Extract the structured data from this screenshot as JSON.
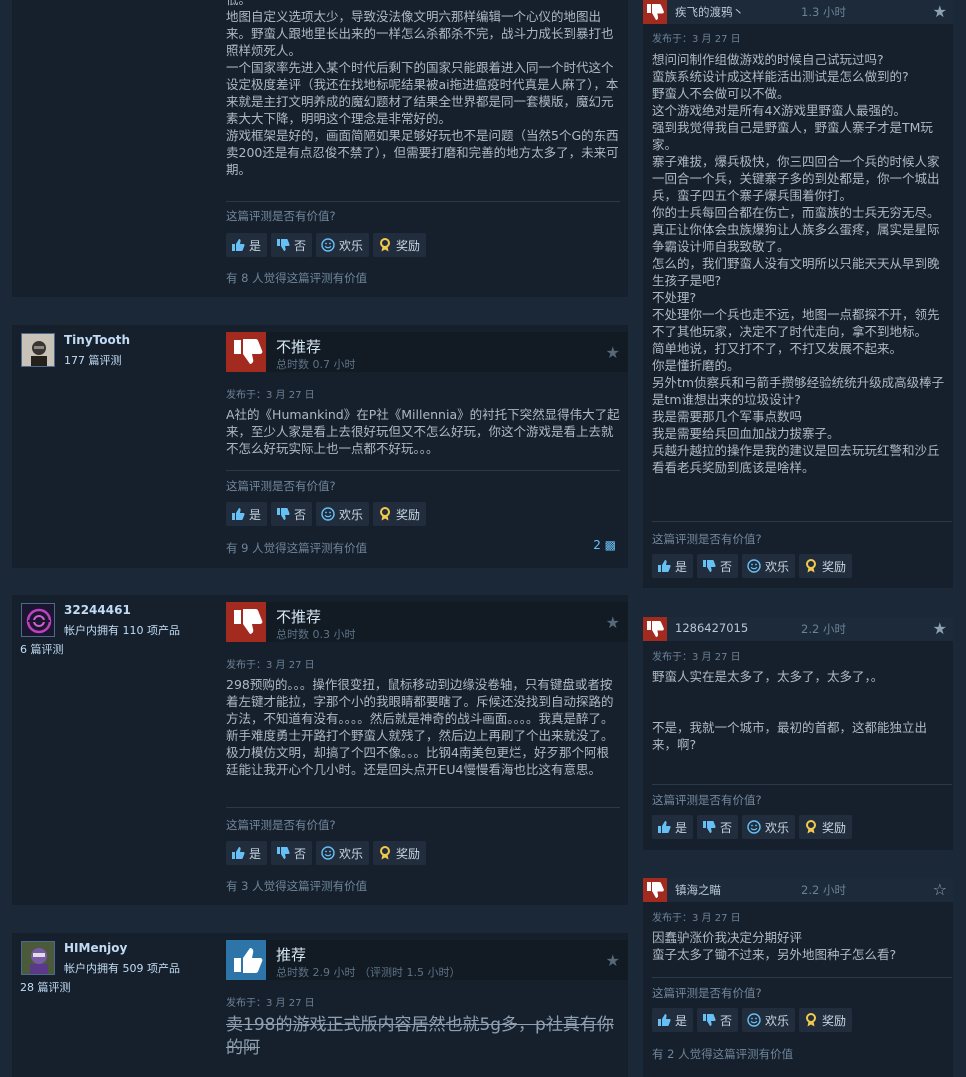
{
  "common": {
    "helpful_question": "这篇评测是否有价值?",
    "yes": "是",
    "no": "否",
    "funny": "欢乐",
    "award": "奖励"
  },
  "review0": {
    "body": "低。\n地图自定义选项太少，导致没法像文明六那样编辑一个心仪的地图出来。野蛮人跟地里长出来的一样怎么杀都杀不完，战斗力成长到暴打也照样烦死人。\n一个国家率先进入某个时代后剩下的国家只能跟着进入同一个时代这个设定极度差评（我还在找地标呢结果被ai拖进瘟疫时代真是人麻了），本来就是主打文明养成的魔幻题材了结果全世界都是同一套模版，魔幻元素大大下降，明明这个理念是非常好的。\n游戏框架是好的，画面简陋如果足够好玩也不是问题（当然5个G的东西卖200还是有点忍俊不禁了），但需要打磨和完善的地方太多了，未来可期。",
    "found": "有 8 人觉得这篇评测有价值"
  },
  "review1": {
    "user": "TinyTooth",
    "info": "177 篇评测",
    "verdict": "不推荐",
    "hours": "总时数 0.7 小时",
    "posted": "发布于：3 月 27 日",
    "body": "A社的《Humankind》在P社《Millennia》的衬托下突然显得伟大了起来，至少人家是看上去很好玩但又不怎么好玩，你这个游戏是看上去就不怎么好玩实际上也一点都不好玩。。。",
    "found": "有 9 人觉得这篇评测有价值",
    "comments": "2"
  },
  "review2": {
    "user": "32244461",
    "info": "帐户内拥有 110 项产品",
    "info2": "6 篇评测",
    "verdict": "不推荐",
    "hours": "总时数 0.3 小时",
    "posted": "发布于：3 月 27 日",
    "body": "298预购的。。。操作很变扭，鼠标移动到边缘没卷轴，只有键盘或者按着左键才能拉，字那个小的我眼睛都要瞎了。斥候还没找到自动探路的方法，不知道有没有。。。。然后就是神奇的战斗画面。。。。我真是醉了。新手难度勇士开路打个野蛮人就残了，然后边上再刷了个出来就没了。极力模仿文明，却搞了个四不像。。。比钢4南美包更烂，好歹那个阿根廷能让我开心个几小时。还是回头点开EU4慢慢看海也比这有意思。",
    "found": "有 3 人觉得这篇评测有价值"
  },
  "review3": {
    "user": "HIMenjoy",
    "info": "帐户内拥有 509 项产品",
    "info2": "28 篇评测",
    "verdict": "推荐",
    "hours": "总时数 2.9 小时  （评测时 1.5 小时）",
    "posted": "发布于：3 月 27 日",
    "body": "卖198的游戏正式版内容居然也就5g多，p社真有你的阿"
  },
  "rreview0": {
    "user": "疾飞的渡鸦丶",
    "hours": "1.3 小时",
    "posted": "发布于：3 月 27 日",
    "body": "想问问制作组做游戏的时候自己试玩过吗?\n蛮族系统设计成这样能活出测试是怎么做到的?\n野蛮人不会做可以不做。\n这个游戏绝对是所有4X游戏里野蛮人最强的。\n强到我觉得我自己是野蛮人，野蛮人寨子才是TM玩家。\n寨子难拔，爆兵极快，你三四回合一个兵的时候人家一回合一个兵，关键寨子多的到处都是，你一个城出兵，蛮子四五个寨子爆兵围着你打。\n你的士兵每回合都在伤亡，而蛮族的士兵无穷无尽。\n真正让你体会虫族爆狗让人族多么蛋疼，属实是星际争霸设计师自我致敬了。\n怎么的，我们野蛮人没有文明所以只能天天从早到晚生孩子是吧?\n不处理?\n不处理你一个兵也走不远，地图一点都探不开，领先不了其他玩家，决定不了时代走向，拿不到地标。\n简单地说，打又打不了，不打又发展不起来。\n你是懂折磨的。\n另外tm侦察兵和弓箭手攒够经验统统升级成高级棒子是tm谁想出来的垃圾设计?\n我是需要那几个军事点数吗\n我是需要给兵回血加战力拔寨子。\n兵越升越拉的操作是我的建议是回去玩玩红警和沙丘看看老兵奖励到底该是啥样。"
  },
  "rreview1": {
    "user": "1286427015",
    "hours": "2.2 小时",
    "posted": "发布于：3 月 27 日",
    "body": "野蛮人实在是太多了，太多了，太多了，。\n\n\n不是，我就一个城市，最初的首都，这都能独立出来，啊?"
  },
  "rreview2": {
    "user": "镇海之瞄",
    "hours": "2.2 小时",
    "posted": "发布于：3 月 27 日",
    "body": "因蠢驴涨价我决定分期好评\n蛮子太多了锄不过来，另外地图种子怎么看?",
    "found": "有 2 人觉得这篇评测有价值"
  }
}
